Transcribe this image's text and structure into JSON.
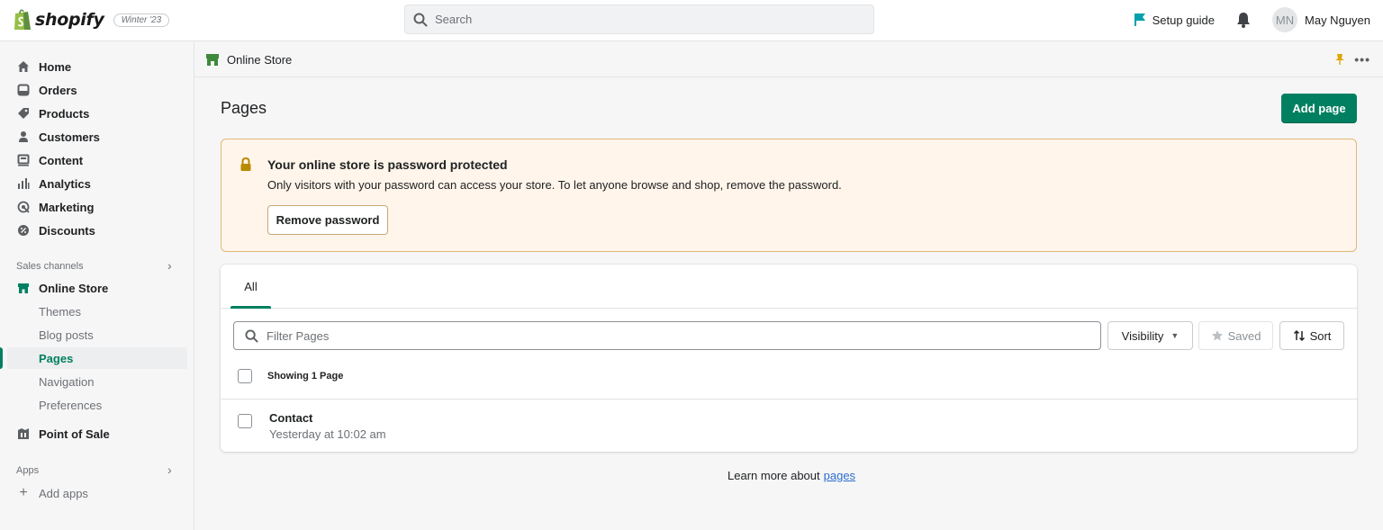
{
  "topbar": {
    "brand": "shopify",
    "edition": "Winter '23",
    "search_placeholder": "Search",
    "setup_guide": "Setup guide",
    "avatar_initials": "MN",
    "user_name": "May Nguyen"
  },
  "sidebar": {
    "main_items": [
      {
        "label": "Home",
        "icon": "home-icon"
      },
      {
        "label": "Orders",
        "icon": "orders-icon"
      },
      {
        "label": "Products",
        "icon": "tag-icon"
      },
      {
        "label": "Customers",
        "icon": "person-icon"
      },
      {
        "label": "Content",
        "icon": "content-icon"
      },
      {
        "label": "Analytics",
        "icon": "bar-chart-icon"
      },
      {
        "label": "Marketing",
        "icon": "target-icon"
      },
      {
        "label": "Discounts",
        "icon": "discount-icon"
      }
    ],
    "sales_channels_label": "Sales channels",
    "online_store": "Online Store",
    "online_store_sub": [
      "Themes",
      "Blog posts",
      "Pages",
      "Navigation",
      "Preferences"
    ],
    "active_sub": "Pages",
    "point_of_sale": "Point of Sale",
    "apps_label": "Apps",
    "add_apps": "Add apps"
  },
  "context_bar": {
    "title": "Online Store"
  },
  "page": {
    "title": "Pages",
    "add_button": "Add page"
  },
  "banner": {
    "title": "Your online store is password protected",
    "body": "Only visitors with your password can access your store. To let anyone browse and shop, remove the password.",
    "button": "Remove password"
  },
  "list": {
    "tabs": [
      "All"
    ],
    "filter_placeholder": "Filter Pages",
    "visibility_label": "Visibility",
    "saved_label": "Saved",
    "sort_label": "Sort",
    "showing_text": "Showing 1 Page",
    "rows": [
      {
        "title": "Contact",
        "subtitle": "Yesterday at 10:02 am"
      }
    ]
  },
  "footer": {
    "prefix": "Learn more about",
    "link": "pages"
  },
  "colors": {
    "primary": "#008060",
    "banner_bg": "#fff5ea",
    "banner_border": "#e1b878",
    "link": "#2c6ecb",
    "warning_icon": "#b98900",
    "pin": "#e0a600"
  }
}
